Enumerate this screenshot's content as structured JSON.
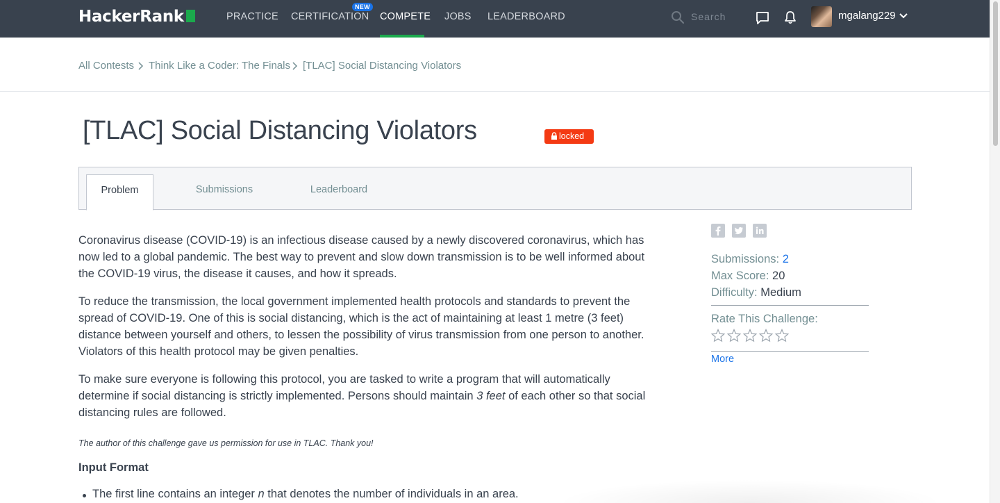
{
  "nav": {
    "logo_text": "HackerRank",
    "items": [
      {
        "label": "PRACTICE"
      },
      {
        "label": "CERTIFICATION"
      },
      {
        "label": "COMPETE"
      },
      {
        "label": "JOBS"
      },
      {
        "label": "LEADERBOARD"
      }
    ],
    "new_badge": "NEW",
    "active_item": "COMPETE",
    "search_placeholder": "Search",
    "username": "mgalang229"
  },
  "breadcrumb": [
    {
      "label": "All Contests"
    },
    {
      "label": "Think Like a Coder: The Finals"
    },
    {
      "label": "[TLAC] Social Distancing Violators"
    }
  ],
  "page": {
    "title": "[TLAC] Social Distancing Violators",
    "locked_label": "locked"
  },
  "tabs": [
    {
      "label": "Problem",
      "active": true
    },
    {
      "label": "Submissions",
      "active": false
    },
    {
      "label": "Leaderboard",
      "active": false
    }
  ],
  "problem": {
    "paragraph_1": "Coronavirus disease (COVID-19) is an infectious disease caused by a newly discovered coronavirus, which has now led to a global pandemic. The best way to prevent and slow down transmission is to be well informed about the COVID-19 virus, the disease it causes, and how it spreads.",
    "paragraph_2": "To reduce the transmission, the local government implemented health protocols and standards to prevent the spread of COVID-19. One of this is social distancing, which is the act of maintaining at least 1 metre (3 feet) distance between yourself and others, to lessen the possibility of virus transmission from one person to another. Violators of this health protocol may be given penalties.",
    "paragraph_3_before": "To make sure everyone is following this protocol, you are tasked to write a program that will automatically determine if social distancing is strictly implemented. Persons should maintain ",
    "paragraph_3_emphasis": "3 feet",
    "paragraph_3_after": " of each other so that social distancing rules are followed.",
    "credit": "The author of this challenge gave us permission for use in TLAC. Thank you!",
    "input_format_heading": "Input Format",
    "input_bullet_before": "The first line contains an integer ",
    "input_bullet_var": "n",
    "input_bullet_after": " that denotes the number of individuals in an area."
  },
  "sidebar": {
    "share_icons": [
      "facebook-icon",
      "twitter-icon",
      "linkedin-icon"
    ],
    "submissions_label": "Submissions:",
    "submissions_value": "2",
    "max_score_label": "Max Score:",
    "max_score_value": "20",
    "difficulty_label": "Difficulty:",
    "difficulty_value": "Medium",
    "rate_label": "Rate This Challenge:",
    "star_rating": 0,
    "star_count": 5,
    "more_label": "More"
  },
  "colors": {
    "nav_bg": "#39424e",
    "brand_green": "#1ba94c",
    "locked_red": "#f43a13",
    "link_blue": "#1a73e8",
    "muted_text": "#738f93"
  }
}
